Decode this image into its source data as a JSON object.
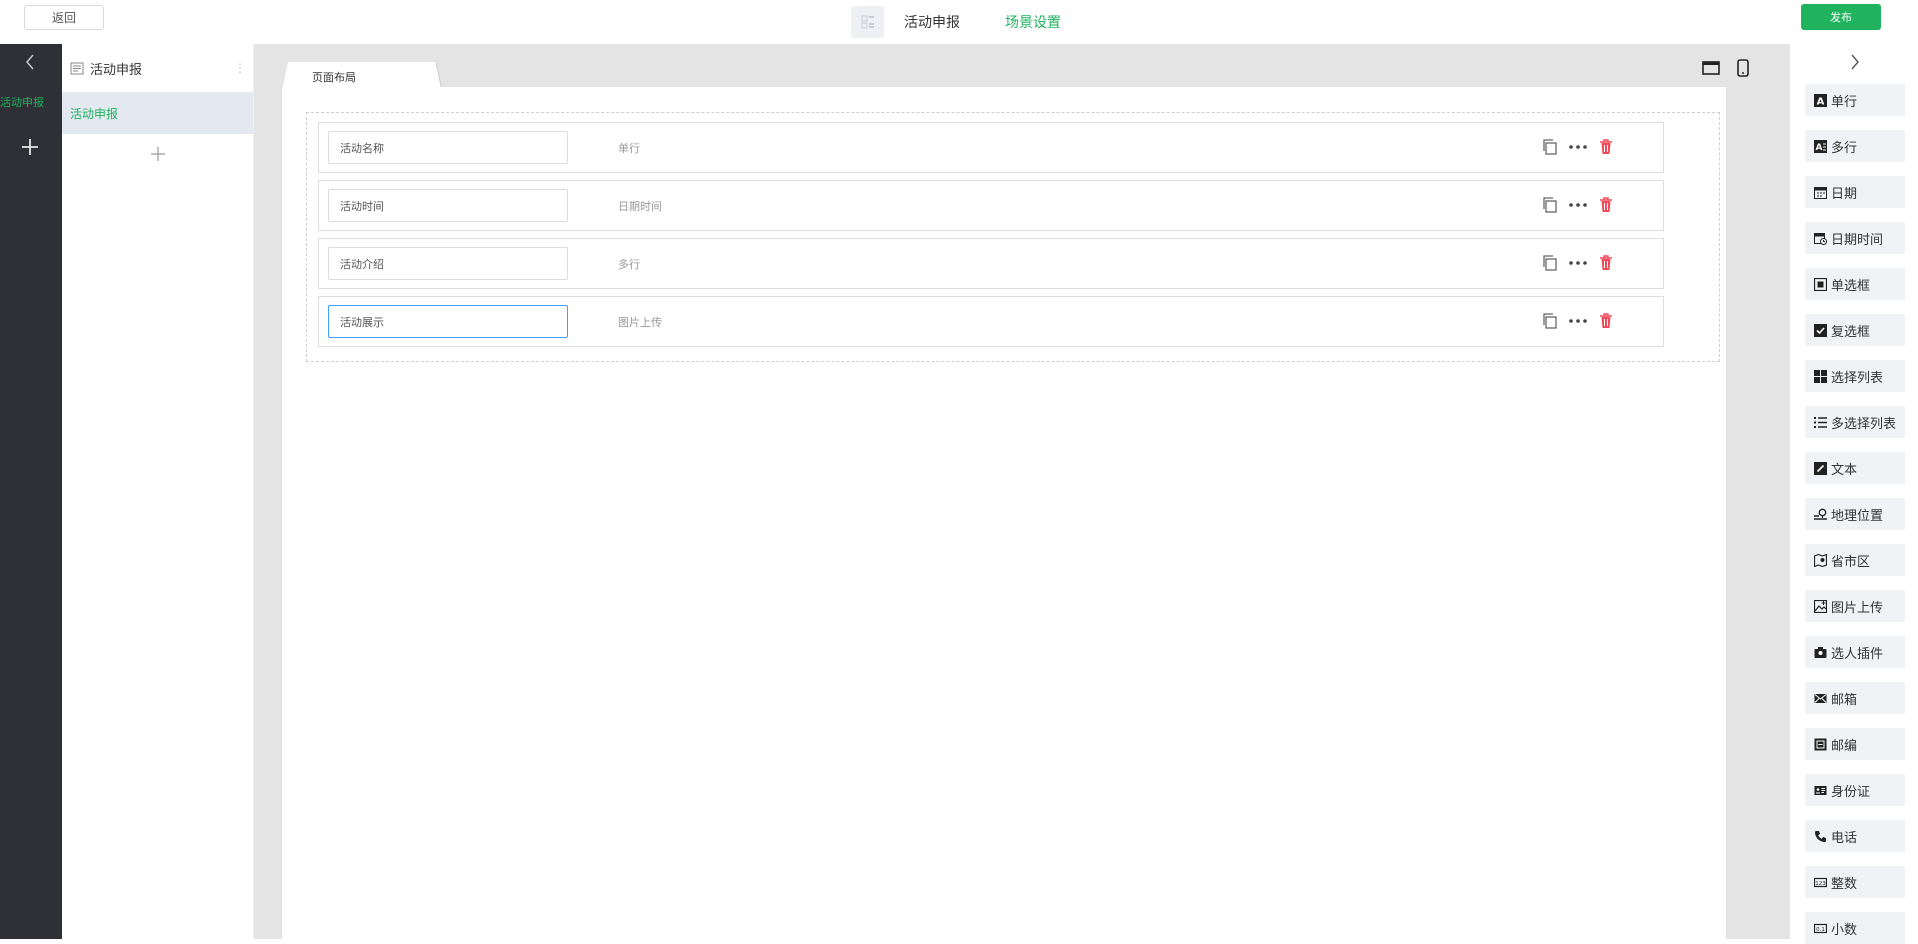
{
  "header": {
    "back_label": "返回",
    "form_tab": "活动申报",
    "scene_tab": "场景设置",
    "publish_label": "发布",
    "grid_icon": "grid-icon"
  },
  "leftbar": {
    "active_label": "活动申报",
    "collapse_icon": "chevron-left-icon",
    "add_icon": "plus-icon"
  },
  "pages": {
    "title": "活动申报",
    "items": [
      {
        "label": "活动申报"
      }
    ],
    "add_icon": "plus-icon"
  },
  "canvas": {
    "tab_label": "页面布局",
    "fields": [
      {
        "label": "活动名称",
        "type": "单行"
      },
      {
        "label": "活动时间",
        "type": "日期时间"
      },
      {
        "label": "活动介绍",
        "type": "多行"
      },
      {
        "label": "活动展示",
        "type": "图片上传",
        "focused": true
      }
    ]
  },
  "components": {
    "items": [
      {
        "label": "单行",
        "icon": "single-line-icon"
      },
      {
        "label": "多行",
        "icon": "multi-line-icon"
      },
      {
        "label": "日期",
        "icon": "calendar-icon"
      },
      {
        "label": "日期时间",
        "icon": "calendar-clock-icon"
      },
      {
        "label": "单选框",
        "icon": "radio-icon"
      },
      {
        "label": "复选框",
        "icon": "checkbox-icon"
      },
      {
        "label": "选择列表",
        "icon": "grid-list-icon"
      },
      {
        "label": "多选择列表",
        "icon": "list-icon"
      },
      {
        "label": "文本",
        "icon": "text-edit-icon"
      },
      {
        "label": "地理位置",
        "icon": "location-icon"
      },
      {
        "label": "省市区",
        "icon": "map-icon"
      },
      {
        "label": "图片上传",
        "icon": "image-upload-icon"
      },
      {
        "label": "选人插件",
        "icon": "person-picker-icon"
      },
      {
        "label": "邮箱",
        "icon": "mail-icon"
      },
      {
        "label": "邮编",
        "icon": "postcode-icon"
      },
      {
        "label": "身份证",
        "icon": "id-card-icon"
      },
      {
        "label": "电话",
        "icon": "phone-icon"
      },
      {
        "label": "整数",
        "icon": "integer-icon"
      },
      {
        "label": "小数",
        "icon": "decimal-icon"
      }
    ]
  },
  "colors": {
    "accent": "#1fb35e",
    "sidebar_dark": "#2f3036",
    "delete_red": "#f04b5a",
    "focus_blue": "#409eff"
  }
}
